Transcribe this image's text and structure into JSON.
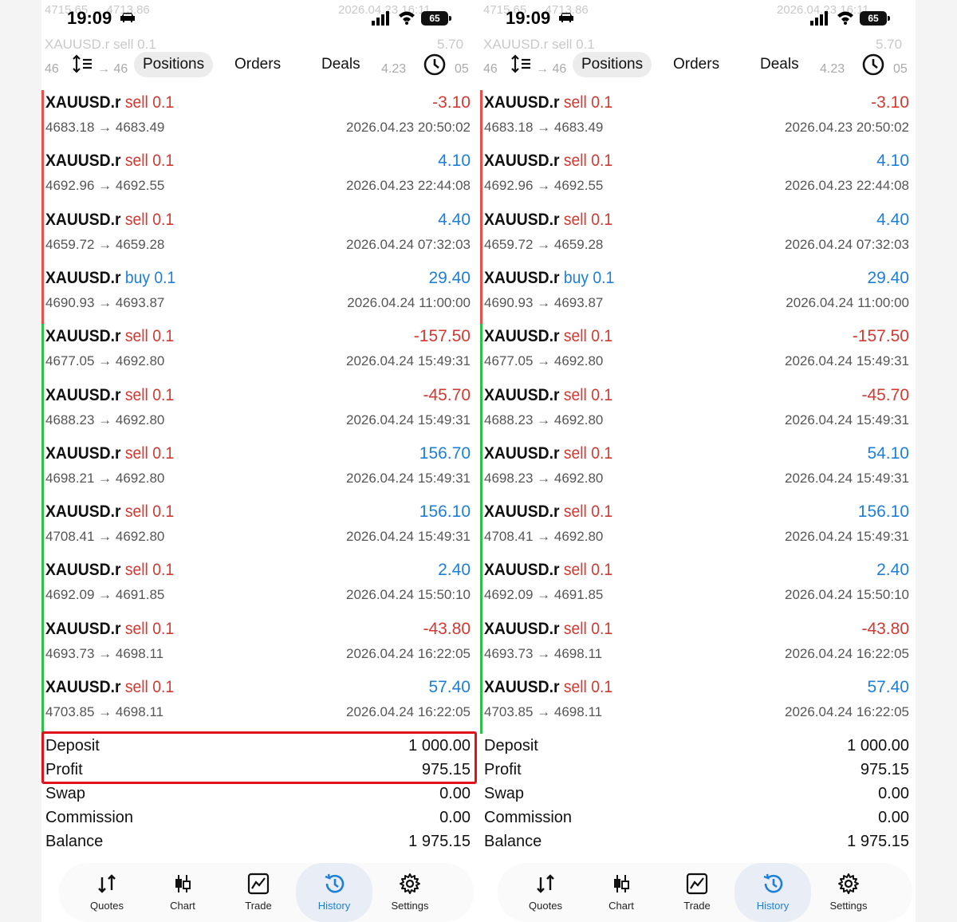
{
  "status": {
    "time": "19:09",
    "battery": "65",
    "ghost_top_left": "4715.65 → 4713.86",
    "ghost_top_right": "2026.04.23 16:11",
    "ghost_row_left": "XAUUSD.r sell 0.1",
    "ghost_row_right": "5.70",
    "ghost_tab_left": "46",
    "ghost_tab_mid": "→ 46",
    "ghost_tab_right": "4.23",
    "ghost_tab_far": "05"
  },
  "tabs": {
    "positions": "Positions",
    "orders": "Orders",
    "deals": "Deals"
  },
  "panels": [
    {
      "trades": [
        {
          "symbol": "XAUUSD.r",
          "side": "sell",
          "volume": "0.1",
          "profit": "-3.10",
          "prices": "4683.18 → 4683.49",
          "datetime": "2026.04.23 20:50:02"
        },
        {
          "symbol": "XAUUSD.r",
          "side": "sell",
          "volume": "0.1",
          "profit": "4.10",
          "prices": "4692.96 → 4692.55",
          "datetime": "2026.04.23 22:44:08"
        },
        {
          "symbol": "XAUUSD.r",
          "side": "sell",
          "volume": "0.1",
          "profit": "4.40",
          "prices": "4659.72 → 4659.28",
          "datetime": "2026.04.24 07:32:03"
        },
        {
          "symbol": "XAUUSD.r",
          "side": "buy",
          "volume": "0.1",
          "profit": "29.40",
          "prices": "4690.93 → 4693.87",
          "datetime": "2026.04.24 11:00:00"
        },
        {
          "symbol": "XAUUSD.r",
          "side": "sell",
          "volume": "0.1",
          "profit": "-157.50",
          "prices": "4677.05 → 4692.80",
          "datetime": "2026.04.24 15:49:31"
        },
        {
          "symbol": "XAUUSD.r",
          "side": "sell",
          "volume": "0.1",
          "profit": "-45.70",
          "prices": "4688.23 → 4692.80",
          "datetime": "2026.04.24 15:49:31"
        },
        {
          "symbol": "XAUUSD.r",
          "side": "sell",
          "volume": "0.1",
          "profit": "156.70",
          "prices": "4698.21 → 4692.80",
          "datetime": "2026.04.24 15:49:31"
        },
        {
          "symbol": "XAUUSD.r",
          "side": "sell",
          "volume": "0.1",
          "profit": "156.10",
          "prices": "4708.41 → 4692.80",
          "datetime": "2026.04.24 15:49:31"
        },
        {
          "symbol": "XAUUSD.r",
          "side": "sell",
          "volume": "0.1",
          "profit": "2.40",
          "prices": "4692.09 → 4691.85",
          "datetime": "2026.04.24 15:50:10"
        },
        {
          "symbol": "XAUUSD.r",
          "side": "sell",
          "volume": "0.1",
          "profit": "-43.80",
          "prices": "4693.73 → 4698.11",
          "datetime": "2026.04.24 16:22:05"
        },
        {
          "symbol": "XAUUSD.r",
          "side": "sell",
          "volume": "0.1",
          "profit": "57.40",
          "prices": "4703.85 → 4698.11",
          "datetime": "2026.04.24 16:22:05"
        }
      ]
    },
    {
      "trades": [
        {
          "symbol": "XAUUSD.r",
          "side": "sell",
          "volume": "0.1",
          "profit": "-3.10",
          "prices": "4683.18 → 4683.49",
          "datetime": "2026.04.23 20:50:02"
        },
        {
          "symbol": "XAUUSD.r",
          "side": "sell",
          "volume": "0.1",
          "profit": "4.10",
          "prices": "4692.96 → 4692.55",
          "datetime": "2026.04.23 22:44:08"
        },
        {
          "symbol": "XAUUSD.r",
          "side": "sell",
          "volume": "0.1",
          "profit": "4.40",
          "prices": "4659.72 → 4659.28",
          "datetime": "2026.04.24 07:32:03"
        },
        {
          "symbol": "XAUUSD.r",
          "side": "buy",
          "volume": "0.1",
          "profit": "29.40",
          "prices": "4690.93 → 4693.87",
          "datetime": "2026.04.24 11:00:00"
        },
        {
          "symbol": "XAUUSD.r",
          "side": "sell",
          "volume": "0.1",
          "profit": "-157.50",
          "prices": "4677.05 → 4692.80",
          "datetime": "2026.04.24 15:49:31"
        },
        {
          "symbol": "XAUUSD.r",
          "side": "sell",
          "volume": "0.1",
          "profit": "-45.70",
          "prices": "4688.23 → 4692.80",
          "datetime": "2026.04.24 15:49:31"
        },
        {
          "symbol": "XAUUSD.r",
          "side": "sell",
          "volume": "0.1",
          "profit": "54.10",
          "prices": "4698.23 → 4692.80",
          "datetime": "2026.04.24 15:49:31"
        },
        {
          "symbol": "XAUUSD.r",
          "side": "sell",
          "volume": "0.1",
          "profit": "156.10",
          "prices": "4708.41 → 4692.80",
          "datetime": "2026.04.24 15:49:31"
        },
        {
          "symbol": "XAUUSD.r",
          "side": "sell",
          "volume": "0.1",
          "profit": "2.40",
          "prices": "4692.09 → 4691.85",
          "datetime": "2026.04.24 15:50:10"
        },
        {
          "symbol": "XAUUSD.r",
          "side": "sell",
          "volume": "0.1",
          "profit": "-43.80",
          "prices": "4693.73 → 4698.11",
          "datetime": "2026.04.24 16:22:05"
        },
        {
          "symbol": "XAUUSD.r",
          "side": "sell",
          "volume": "0.1",
          "profit": "57.40",
          "prices": "4703.85 → 4698.11",
          "datetime": "2026.04.24 16:22:05"
        }
      ]
    }
  ],
  "summary": {
    "deposit_label": "Deposit",
    "deposit": "1 000.00",
    "profit_label": "Profit",
    "profit": "975.15",
    "swap_label": "Swap",
    "swap": "0.00",
    "commission_label": "Commission",
    "commission": "0.00",
    "balance_label": "Balance",
    "balance": "1 975.15"
  },
  "nav": {
    "quotes": "Quotes",
    "chart": "Chart",
    "trade": "Trade",
    "history": "History",
    "settings": "Settings"
  },
  "colors": {
    "sell": "#d13a32",
    "buy": "#1e7fd8",
    "highlight_box": "#e0121c",
    "loss_bar": "#e8514a",
    "gain_bar": "#2fbf4a"
  }
}
